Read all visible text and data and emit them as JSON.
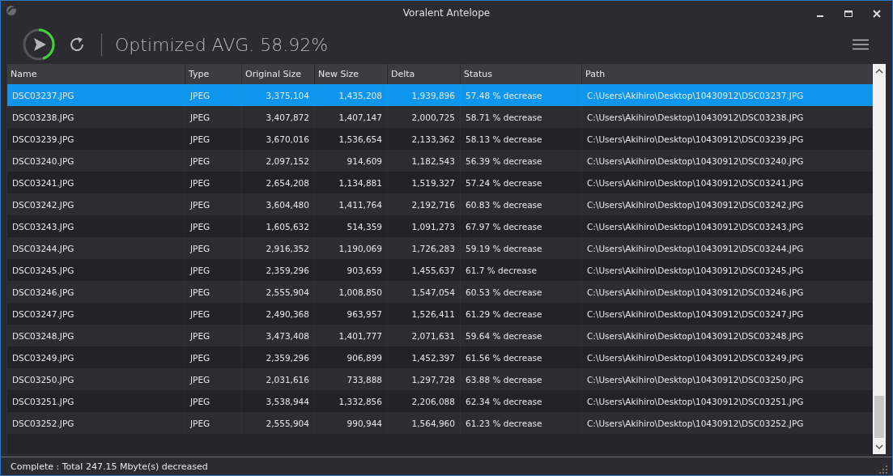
{
  "window": {
    "title": "Voralent Antelope"
  },
  "toolbar": {
    "progress": {
      "level": 0.45
    },
    "summary": "Optimized AVG. 58.92%"
  },
  "table": {
    "columns": [
      "Name",
      "Type",
      "Original Size",
      "New Size",
      "Delta",
      "Status",
      "Path"
    ],
    "rows": [
      {
        "selected": true,
        "cells": [
          "DSC03237.JPG",
          "JPEG",
          "3,375,104",
          "1,435,208",
          "1,939,896",
          "57.48 % decrease",
          "C:\\Users\\Akihiro\\Desktop\\10430912\\DSC03237.JPG"
        ]
      },
      {
        "selected": false,
        "cells": [
          "DSC03238.JPG",
          "JPEG",
          "3,407,872",
          "1,407,147",
          "2,000,725",
          "58.71 % decrease",
          "C:\\Users\\Akihiro\\Desktop\\10430912\\DSC03238.JPG"
        ]
      },
      {
        "selected": false,
        "cells": [
          "DSC03239.JPG",
          "JPEG",
          "3,670,016",
          "1,536,654",
          "2,133,362",
          "58.13 % decrease",
          "C:\\Users\\Akihiro\\Desktop\\10430912\\DSC03239.JPG"
        ]
      },
      {
        "selected": false,
        "cells": [
          "DSC03240.JPG",
          "JPEG",
          "2,097,152",
          "914,609",
          "1,182,543",
          "56.39 % decrease",
          "C:\\Users\\Akihiro\\Desktop\\10430912\\DSC03240.JPG"
        ]
      },
      {
        "selected": false,
        "cells": [
          "DSC03241.JPG",
          "JPEG",
          "2,654,208",
          "1,134,881",
          "1,519,327",
          "57.24 % decrease",
          "C:\\Users\\Akihiro\\Desktop\\10430912\\DSC03241.JPG"
        ]
      },
      {
        "selected": false,
        "cells": [
          "DSC03242.JPG",
          "JPEG",
          "3,604,480",
          "1,411,764",
          "2,192,716",
          "60.83 % decrease",
          "C:\\Users\\Akihiro\\Desktop\\10430912\\DSC03242.JPG"
        ]
      },
      {
        "selected": false,
        "cells": [
          "DSC03243.JPG",
          "JPEG",
          "1,605,632",
          "514,359",
          "1,091,273",
          "67.97 % decrease",
          "C:\\Users\\Akihiro\\Desktop\\10430912\\DSC03243.JPG"
        ]
      },
      {
        "selected": false,
        "cells": [
          "DSC03244.JPG",
          "JPEG",
          "2,916,352",
          "1,190,069",
          "1,726,283",
          "59.19 % decrease",
          "C:\\Users\\Akihiro\\Desktop\\10430912\\DSC03244.JPG"
        ]
      },
      {
        "selected": false,
        "cells": [
          "DSC03245.JPG",
          "JPEG",
          "2,359,296",
          "903,659",
          "1,455,637",
          "61.7 % decrease",
          "C:\\Users\\Akihiro\\Desktop\\10430912\\DSC03245.JPG"
        ]
      },
      {
        "selected": false,
        "cells": [
          "DSC03246.JPG",
          "JPEG",
          "2,555,904",
          "1,008,850",
          "1,547,054",
          "60.53 % decrease",
          "C:\\Users\\Akihiro\\Desktop\\10430912\\DSC03246.JPG"
        ]
      },
      {
        "selected": false,
        "cells": [
          "DSC03247.JPG",
          "JPEG",
          "2,490,368",
          "963,957",
          "1,526,411",
          "61.29 % decrease",
          "C:\\Users\\Akihiro\\Desktop\\10430912\\DSC03247.JPG"
        ]
      },
      {
        "selected": false,
        "cells": [
          "DSC03248.JPG",
          "JPEG",
          "3,473,408",
          "1,401,777",
          "2,071,631",
          "59.64 % decrease",
          "C:\\Users\\Akihiro\\Desktop\\10430912\\DSC03248.JPG"
        ]
      },
      {
        "selected": false,
        "cells": [
          "DSC03249.JPG",
          "JPEG",
          "2,359,296",
          "906,899",
          "1,452,397",
          "61.56 % decrease",
          "C:\\Users\\Akihiro\\Desktop\\10430912\\DSC03249.JPG"
        ]
      },
      {
        "selected": false,
        "cells": [
          "DSC03250.JPG",
          "JPEG",
          "2,031,616",
          "733,888",
          "1,297,728",
          "63.88 % decrease",
          "C:\\Users\\Akihiro\\Desktop\\10430912\\DSC03250.JPG"
        ]
      },
      {
        "selected": false,
        "cells": [
          "DSC03251.JPG",
          "JPEG",
          "3,538,944",
          "1,332,856",
          "2,206,088",
          "62.34 % decrease",
          "C:\\Users\\Akihiro\\Desktop\\10430912\\DSC03251.JPG"
        ]
      },
      {
        "selected": false,
        "cells": [
          "DSC03252.JPG",
          "JPEG",
          "2,555,904",
          "990,944",
          "1,564,960",
          "61.23 % decrease",
          "C:\\Users\\Akihiro\\Desktop\\10430912\\DSC03252.JPG"
        ]
      }
    ]
  },
  "status_bar": {
    "text": "Complete : Total 247.15 Mbyte(s) decreased"
  }
}
